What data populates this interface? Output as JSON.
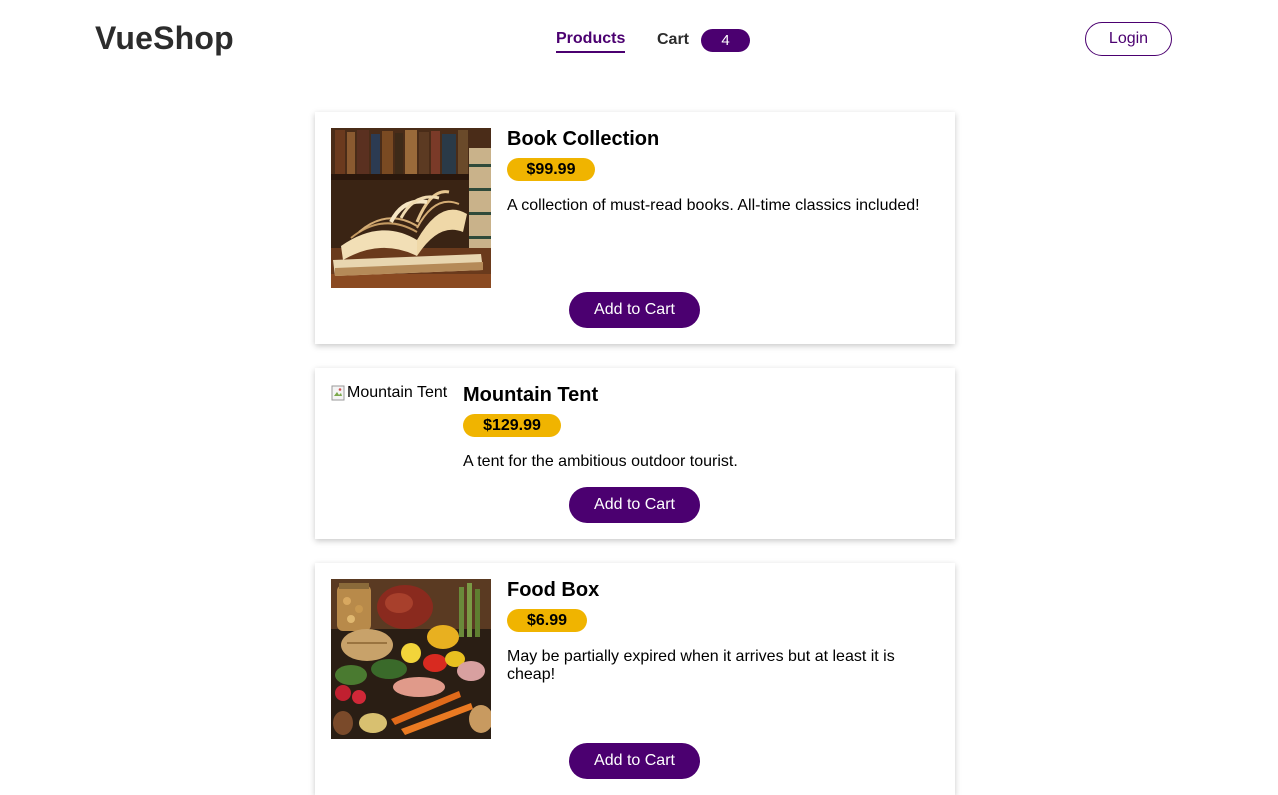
{
  "header": {
    "logo": "VueShop",
    "nav": {
      "products_label": "Products",
      "cart_label": "Cart",
      "cart_count": "4"
    },
    "login_label": "Login"
  },
  "colors": {
    "brand": "#4b0070",
    "price_badge": "#f0b400"
  },
  "products": [
    {
      "name": "Book Collection",
      "price": "$99.99",
      "description": "A collection of must-read books. All-time classics included!",
      "image_alt": "Book Collection",
      "image_loaded": true,
      "image_subject": "open-books-photo",
      "button_label": "Add to Cart"
    },
    {
      "name": "Mountain Tent",
      "price": "$129.99",
      "description": "A tent for the ambitious outdoor tourist.",
      "image_alt": "Mountain Tent",
      "image_loaded": false,
      "button_label": "Add to Cart"
    },
    {
      "name": "Food Box",
      "price": "$6.99",
      "description": "May be partially expired when it arrives but at least it is cheap!",
      "image_alt": "Food Box",
      "image_loaded": true,
      "image_subject": "assorted-food-photo",
      "button_label": "Add to Cart"
    }
  ]
}
